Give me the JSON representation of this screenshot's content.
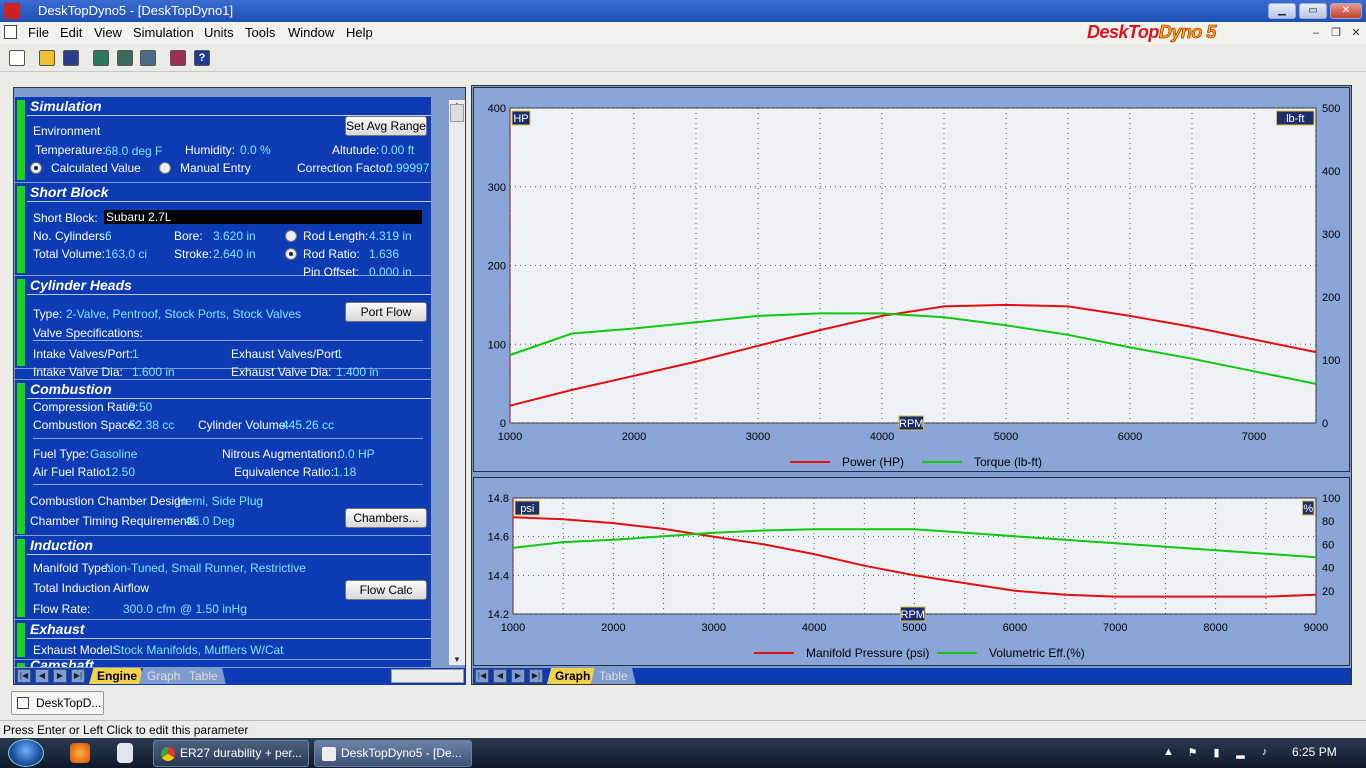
{
  "window": {
    "title": "DeskTopDyno5 - [DeskTopDyno1]"
  },
  "menu": [
    "File",
    "Edit",
    "View",
    "Simulation",
    "Units",
    "Tools",
    "Window",
    "Help"
  ],
  "brand": {
    "part1": "DeskTop",
    "part2": "Dyno",
    "part3": "5"
  },
  "simulation": {
    "header": "Simulation",
    "environment": "Environment",
    "set_avg_range": "Set Avg Range",
    "temperature_label": "Temperature:",
    "temperature": "68.0 deg F",
    "humidity_label": "Humidity:",
    "humidity": "0.0 %",
    "altitude_label": "Altutude:",
    "altitude": "0.00 ft",
    "calculated": "Calculated Value",
    "manual": "Manual Entry",
    "correction_label": "Correction Factor:",
    "correction": "0.99997"
  },
  "short_block": {
    "header": "Short Block",
    "block_label": "Short Block:",
    "block": "Subaru 2.7L",
    "cyl_label": "No. Cylinders:",
    "cyl": "6",
    "bore_label": "Bore:",
    "bore": "3.620 in",
    "rod_len_label": "Rod Length:",
    "rod_len": "4.319 in",
    "vol_label": "Total Volume:",
    "vol": "163.0 ci",
    "stroke_label": "Stroke:",
    "stroke": "2.640 in",
    "rod_ratio_label": "Rod Ratio:",
    "rod_ratio": "1.636",
    "pin_label": "Pin Offset:",
    "pin": "0.000 in"
  },
  "heads": {
    "header": "Cylinder Heads",
    "type_label": "Type:",
    "type": "2-Valve, Pentroof, Stock Ports, Stock Valves",
    "port_flow": "Port Flow",
    "valve_spec": "Valve Specifications:",
    "iv_label": "Intake Valves/Port:",
    "iv": "1",
    "ev_label": "Exhaust Valves/Port:",
    "ev": "1",
    "ivd_label": "Intake Valve Dia:",
    "ivd": "1.600 in",
    "evd_label": "Exhaust Valve Dia:",
    "evd": "1.400 in"
  },
  "combustion": {
    "header": "Combustion",
    "cr_label": "Compression Ratio:",
    "cr": "9.50",
    "cs_label": "Combustion Space:",
    "cs": "52.38 cc",
    "cv_label": "Cylinder Volume:",
    "cv": "445.26 cc",
    "fuel_label": "Fuel Type:",
    "fuel": "Gasoline",
    "nitrous_label": "Nitrous Augmentation:",
    "nitrous": "0.0 HP",
    "afr_label": "Air Fuel Ratio:",
    "afr": "12.50",
    "er_label": "Equivalence Ratio:",
    "er": "1.18",
    "ccd_label": "Combustion Chamber Design:",
    "ccd": "Hemi, Side Plug",
    "ctr_label": "Chamber Timing Requirements:",
    "ctr": "45.0 Deg",
    "chambers": "Chambers..."
  },
  "induction": {
    "header": "Induction",
    "manifold_label": "Manifold Type:",
    "manifold": "Non-Tuned, Small Runner, Restrictive",
    "airflow": "Total Induction Airflow",
    "flow_label": "Flow Rate:",
    "flow": "300.0 cfm",
    "at": "@ 1.50 inHg",
    "flow_calc": "Flow Calc"
  },
  "exhaust": {
    "header": "Exhaust",
    "model_label": "Exhaust Model:",
    "model": "Stock Manifolds, Mufflers W/Cat"
  },
  "camshaft": {
    "header": "Camshaft"
  },
  "left_tabs": [
    "Engine",
    "Graph",
    "Table"
  ],
  "right_tabs": [
    "Graph",
    "Table"
  ],
  "chart_data": [
    {
      "type": "line",
      "x": [
        1000,
        1500,
        2000,
        2500,
        3000,
        3500,
        4000,
        4500,
        5000,
        5500,
        6000,
        6500,
        7000,
        7500
      ],
      "xlabel": "RPM",
      "xticks": [
        1000,
        2000,
        3000,
        4000,
        5000,
        6000,
        7000
      ],
      "xlim": [
        1000,
        7500
      ],
      "left_axis_label": "HP",
      "left_ylim": [
        0,
        400
      ],
      "left_ticks": [
        0,
        100,
        200,
        300,
        400
      ],
      "right_axis_label": "lb-ft",
      "right_ylim": [
        0,
        500
      ],
      "right_ticks": [
        0,
        100,
        200,
        300,
        400,
        500
      ],
      "grid": true,
      "legend": "bottom",
      "series": [
        {
          "name": "Power (HP)",
          "axis": "left",
          "color": "#e01010",
          "values": [
            22,
            42,
            60,
            78,
            98,
            118,
            136,
            148,
            150,
            148,
            136,
            122,
            106,
            90
          ]
        },
        {
          "name": "Torque (lb-ft)",
          "axis": "right",
          "color": "#10c810",
          "values": [
            108,
            142,
            150,
            160,
            170,
            174,
            174,
            168,
            155,
            140,
            120,
            102,
            82,
            62
          ]
        }
      ]
    },
    {
      "type": "line",
      "x": [
        1000,
        1500,
        2000,
        2500,
        3000,
        3500,
        4000,
        4500,
        5000,
        5500,
        6000,
        6500,
        7000,
        7500,
        8000,
        8500,
        9000
      ],
      "xlabel": "RPM",
      "xticks": [
        1000,
        2000,
        3000,
        4000,
        5000,
        6000,
        7000,
        8000,
        9000
      ],
      "xlim": [
        1000,
        9000
      ],
      "left_axis_label": "psi",
      "left_ylim": [
        14.2,
        14.8
      ],
      "left_ticks": [
        14.2,
        14.4,
        14.6,
        14.8
      ],
      "right_axis_label": "%",
      "right_ylim": [
        0,
        100
      ],
      "right_ticks": [
        20,
        40,
        60,
        80,
        100
      ],
      "grid": true,
      "legend": "bottom",
      "series": [
        {
          "name": "Manifold Pressure (psi)",
          "axis": "left",
          "color": "#e01010",
          "values": [
            14.7,
            14.69,
            14.67,
            14.64,
            14.6,
            14.56,
            14.51,
            14.45,
            14.4,
            14.36,
            14.32,
            14.3,
            14.29,
            14.29,
            14.29,
            14.29,
            14.3
          ]
        },
        {
          "name": "Volumetric Eff.(%)",
          "axis": "right",
          "color": "#10c810",
          "values": [
            57,
            62,
            64,
            67,
            70,
            72,
            73,
            73,
            73,
            70,
            67,
            64,
            61,
            58,
            55,
            52,
            49
          ]
        }
      ]
    }
  ],
  "taskstrip": {
    "doc": "DeskTopD..."
  },
  "status": "Press Enter or Left Click to edit this parameter",
  "taskbar": {
    "task1": "ER27 durability + per...",
    "task2": "DeskTopDyno5 - [De...",
    "clock": "6:25 PM"
  }
}
